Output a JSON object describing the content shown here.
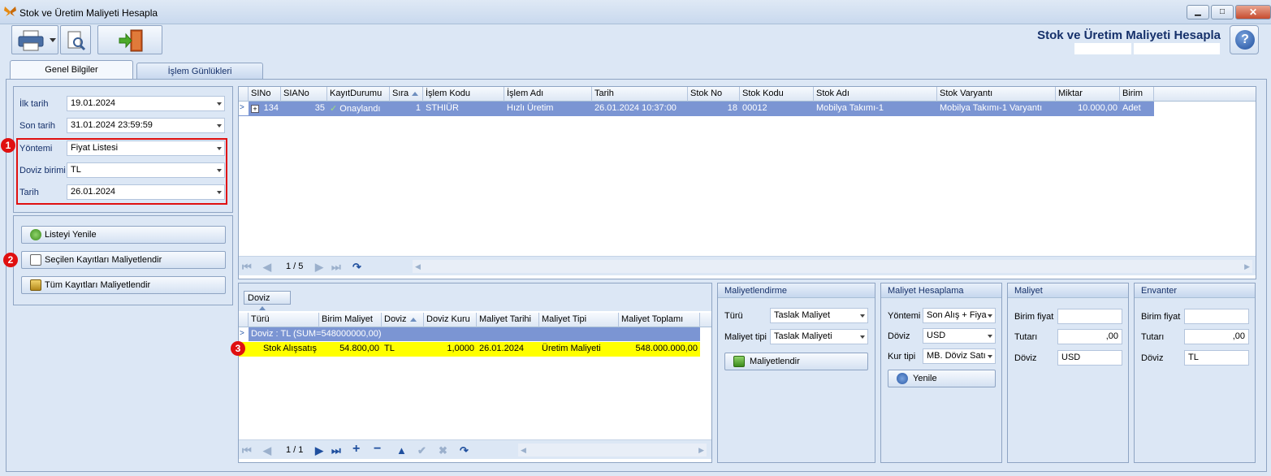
{
  "window": {
    "title": "Stok ve Üretim Maliyeti Hesapla",
    "minimize": "▁",
    "maximize": "□",
    "close": "✕"
  },
  "header": {
    "page_title": "Stok ve Üretim Maliyeti Hesapla",
    "help": "?"
  },
  "tabs": [
    {
      "label": "Genel Bilgiler",
      "active": true
    },
    {
      "label": "İşlem Günlükleri",
      "active": false
    }
  ],
  "filters": {
    "ilk_tarih": {
      "label": "İlk tarih",
      "value": "19.01.2024"
    },
    "son_tarih": {
      "label": "Son tarih",
      "value": "31.01.2024 23:59:59"
    },
    "yontemi": {
      "label": "Yöntemi",
      "value": "Fiyat Listesi"
    },
    "doviz_birimi": {
      "label": "Doviz birimi",
      "value": "TL"
    },
    "tarih": {
      "label": "Tarih",
      "value": "26.01.2024"
    }
  },
  "badges": [
    "1",
    "2",
    "3"
  ],
  "actions": {
    "listeyi_yenile": "Listeyi Yenile",
    "secilen_kayitlari": "Seçilen Kayıtları Maliyetlendir",
    "tum_kayitlari": "Tüm Kayıtları Maliyetlendir"
  },
  "main_grid": {
    "columns": [
      "SINo",
      "SIANo",
      "KayıtDurumu",
      "Sıra",
      "İşlem Kodu",
      "İşlem Adı",
      "Tarih",
      "Stok No",
      "Stok Kodu",
      "Stok Adı",
      "Stok Varyantı",
      "Miktar",
      "Birim"
    ],
    "rows": [
      {
        "SINo": "134",
        "SIANo": "35",
        "KayitDurumu": "Onaylandı",
        "Sira": "1",
        "IslemKodu": "STHIÜR",
        "IslemAdi": "Hızlı Üretim",
        "Tarih": "26.01.2024 10:37:00",
        "StokNo": "18",
        "StokKodu": "00012",
        "StokAdi": "Mobilya Takımı-1",
        "StokVaryanti": "Mobilya Takımı-1 Varyantı",
        "Miktar": "10.000,00",
        "Birim": "Adet"
      }
    ],
    "page": "1 / 5",
    "expand": "+",
    "check": "✓"
  },
  "detail_grid": {
    "group_by": "Doviz",
    "columns": [
      "Türü",
      "Birim Maliyet",
      "Doviz",
      "Doviz Kuru",
      "Maliyet Tarihi",
      "Maliyet Tipi",
      "Maliyet Toplamı"
    ],
    "group_row": "Doviz : TL (SUM=548000000,00)",
    "rows": [
      {
        "Turu": "Stok Alışsatış",
        "BirimMaliyet": "54.800,00",
        "Doviz": "TL",
        "DovizKuru": "1,0000",
        "MaliyetTarihi": "26.01.2024",
        "MaliyetTipi": "Üretim Maliyeti",
        "MaliyetToplami": "548.000.000,00"
      }
    ],
    "page": "1 / 1"
  },
  "maliyetlendirme": {
    "title": "Maliyetlendirme",
    "turu_label": "Türü",
    "turu_value": "Taslak Maliyet",
    "tipi_label": "Maliyet tipi",
    "tipi_value": "Taslak Maliyeti",
    "button": "Maliyetlendir"
  },
  "maliyet_hesaplama": {
    "title": "Maliyet Hesaplama",
    "yontemi_label": "Yöntemi",
    "yontemi_value": "Son Alış + Fiya",
    "doviz_label": "Döviz",
    "doviz_value": "USD",
    "kur_label": "Kur tipi",
    "kur_value": "MB. Döviz Satı",
    "button": "Yenile"
  },
  "maliyet": {
    "title": "Maliyet",
    "birim_label": "Birim fiyat",
    "birim_value": "",
    "tutar_label": "Tutarı",
    "tutar_value": ",00",
    "doviz_label": "Döviz",
    "doviz_value": "USD"
  },
  "envanter": {
    "title": "Envanter",
    "birim_label": "Birim fiyat",
    "birim_value": "",
    "tutar_label": "Tutarı",
    "tutar_value": ",00",
    "doviz_label": "Döviz",
    "doviz_value": "TL"
  }
}
